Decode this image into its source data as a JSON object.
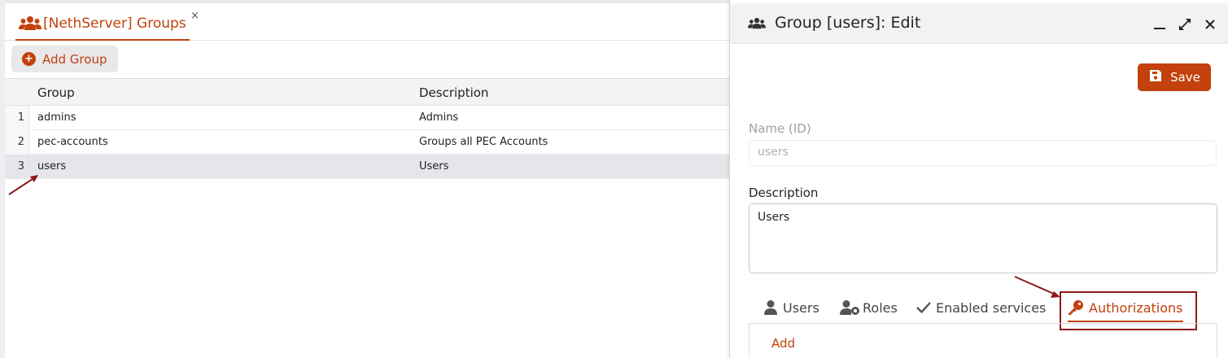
{
  "left_tab": {
    "label": "[NethServer] Groups",
    "close": "×"
  },
  "toolbar": {
    "add_label": "Add Group",
    "add_icon": "plus-circle-icon"
  },
  "table": {
    "columns": [
      "Group",
      "Description"
    ],
    "rows": [
      {
        "num": "1",
        "group": "admins",
        "description": "Admins"
      },
      {
        "num": "2",
        "group": "pec-accounts",
        "description": "Groups all PEC Accounts"
      },
      {
        "num": "3",
        "group": "users",
        "description": "Users"
      }
    ],
    "selected_row": 3
  },
  "edit_panel": {
    "title": "Group [users]: Edit",
    "save_label": "Save",
    "name_label": "Name (ID)",
    "name_value": "users",
    "description_label": "Description",
    "description_value": "Users",
    "tabs": [
      {
        "label": "Users",
        "icon": "user-icon"
      },
      {
        "label": "Roles",
        "icon": "user-gear-icon"
      },
      {
        "label": "Enabled services",
        "icon": "check-icon"
      },
      {
        "label": "Authorizations",
        "icon": "key-icon",
        "active": true
      }
    ],
    "add_link": "Add"
  },
  "colors": {
    "accent": "#c2410c",
    "annotation": "#8b1a1a"
  }
}
